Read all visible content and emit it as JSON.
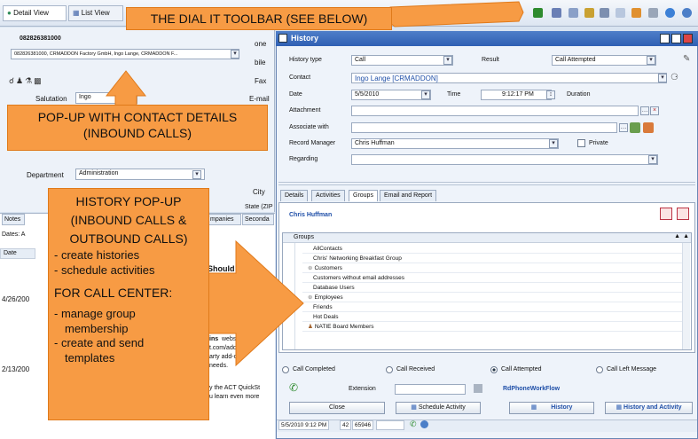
{
  "header": {
    "detail_tab": "Detail View",
    "list_tab": "List View"
  },
  "contact": {
    "phone_number": "082826381000",
    "summary": "082826381000, CRMADDON Factory GmbH, Ingo Lange, CRMADDON F...",
    "salutation_label": "Salutation",
    "salutation_value": "Ingo",
    "department_label": "Department",
    "department_value": "Administration",
    "field_labels": {
      "phone": "one",
      "mobile": "bile",
      "fax": "Fax",
      "email": "E-mail",
      "city": "City",
      "state": "State (ZIP"
    }
  },
  "notes": {
    "tab_notes": "Notes",
    "tab_companies": "mpanies",
    "tab_secondary": "Seconda",
    "dates_label": "Dates: A",
    "date_col": "Date",
    "dates": [
      "4/26/200",
      "2/13/200"
    ],
    "snippet_heading": "Should K",
    "snippet_1": "ins",
    "snippet_2": "websi",
    "snippet_3": "t.com/add",
    "snippet_4": "arty add-on",
    "snippet_5": "needs.",
    "snippet_6": "y the ACT QuickSt",
    "snippet_7": "u learn even more"
  },
  "callouts": {
    "toolbar": "THE DIAL IT TOOLBAR (SEE BELOW)",
    "popup_line1": "POP-UP WITH CONTACT DETAILS",
    "popup_line2": "(INBOUND CALLS)",
    "history_lines": [
      "HISTORY POP-UP",
      "(INBOUND CALLS &",
      "OUTBOUND CALLS)",
      "- create histories",
      "- schedule activities",
      "FOR CALL CENTER:",
      "- manage group",
      "membership",
      "- create and send",
      "templates"
    ]
  },
  "history": {
    "title": "History",
    "type_label": "History type",
    "type_value": "Call",
    "result_label": "Result",
    "result_value": "Call Attempted",
    "contact_label": "Contact",
    "contact_value": "Ingo Lange [CRMADDON]",
    "date_label": "Date",
    "date_value": "5/5/2010",
    "time_label": "Time",
    "time_value": "9:12:17 PM",
    "duration_label": "Duration",
    "attachment_label": "Attachment",
    "associate_label": "Associate with",
    "record_manager_label": "Record Manager",
    "record_manager_value": "Chris Huffman",
    "private_label": "Private",
    "regarding_label": "Regarding",
    "tabs": [
      "Details",
      "Activities",
      "Groups",
      "Email and Report"
    ],
    "groups_user": "Chris Huffman",
    "groups_header": "Groups",
    "groups": [
      "AllContacts",
      "Chris' Networking Breakfast Group",
      "Customers",
      "Customers without email addresses",
      "Database Users",
      "Employees",
      "Friends",
      "Hot Deals",
      "NATIE Board Members"
    ],
    "radios": [
      "Call Completed",
      "Call Received",
      "Call Attempted",
      "Call Left Message"
    ],
    "extension_label": "Extension",
    "workflow_label": "RdPhoneWorkFlow",
    "close_btn": "Close",
    "schedule_btn": "Schedule Activity",
    "history_btn": "History",
    "history_activity_btn": "History and Activity",
    "status_date": "5/5/2010 9:12 PM",
    "status_n1": "42",
    "status_n2": "65946"
  },
  "colors": {
    "callout": "#f79b44",
    "titlebar": "#2f5fb3",
    "link": "#1f4fa8"
  }
}
